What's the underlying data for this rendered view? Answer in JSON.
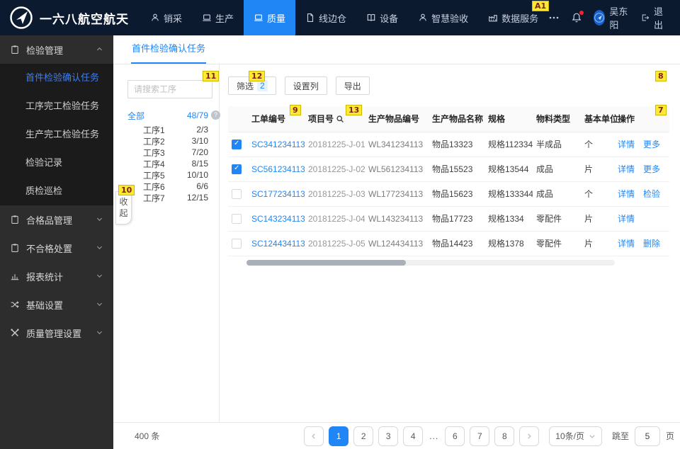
{
  "topnav": {
    "brand": "一六八航空航天",
    "items": [
      {
        "label": "销采",
        "icon": "person-icon",
        "active": false
      },
      {
        "label": "生产",
        "icon": "laptop-icon",
        "active": false
      },
      {
        "label": "质量",
        "icon": "laptop-icon",
        "active": true
      },
      {
        "label": "线边仓",
        "icon": "file-icon",
        "active": false
      },
      {
        "label": "设备",
        "icon": "book-icon",
        "active": false
      },
      {
        "label": "智慧验收",
        "icon": "person-icon",
        "active": false
      },
      {
        "label": "数据服务",
        "icon": "factory-icon",
        "active": false
      }
    ],
    "user": "吴东阳",
    "logout_label": "退出"
  },
  "sidebar": {
    "groups": [
      {
        "label": "检验管理",
        "icon": "clipboard-icon",
        "expanded": true,
        "children": [
          {
            "label": "首件检验确认任务",
            "active": true
          },
          {
            "label": "工序完工检验任务",
            "active": false
          },
          {
            "label": "生产完工检验任务",
            "active": false
          },
          {
            "label": "检验记录",
            "active": false
          },
          {
            "label": "质检巡检",
            "active": false
          }
        ]
      },
      {
        "label": "合格品管理",
        "icon": "clipboard-icon",
        "expanded": false
      },
      {
        "label": "不合格处置",
        "icon": "clipboard-icon",
        "expanded": false
      },
      {
        "label": "报表统计",
        "icon": "chart-icon",
        "expanded": false
      },
      {
        "label": "基础设置",
        "icon": "shuffle-icon",
        "expanded": false
      },
      {
        "label": "质量管理设置",
        "icon": "tools-icon",
        "expanded": false
      }
    ]
  },
  "tabbar": {
    "active_tab": "首件检验确认任务"
  },
  "filter_panel": {
    "search_placeholder": "请搜索工序",
    "all_label": "全部",
    "all_count": "48/79",
    "items": [
      {
        "name": "工序1",
        "count": "2/3"
      },
      {
        "name": "工序2",
        "count": "3/10"
      },
      {
        "name": "工序3",
        "count": "7/20"
      },
      {
        "name": "工序4",
        "count": "8/15"
      },
      {
        "name": "工序5",
        "count": "10/10"
      },
      {
        "name": "工序6",
        "count": "6/6"
      },
      {
        "name": "工序7",
        "count": "12/15"
      }
    ],
    "collapse_label": "收起"
  },
  "toolbar": {
    "filter_label": "筛选",
    "filter_count": "2",
    "columns_label": "设置列",
    "export_label": "导出"
  },
  "table": {
    "headers": [
      "工单编号",
      "项目号",
      "生产物品编号",
      "生产物品名称",
      "规格",
      "物料类型",
      "基本单位",
      "操作"
    ],
    "rows": [
      {
        "checked": true,
        "order": "SC341234113",
        "project": "20181225-J-01",
        "item_code": "WL341234113",
        "item_name": "物品13323",
        "spec": "规格112334",
        "material_type": "半成品",
        "unit": "个",
        "actions": [
          "详情",
          "更多"
        ]
      },
      {
        "checked": true,
        "order": "SC561234113",
        "project": "20181225-J-02",
        "item_code": "WL561234113",
        "item_name": "物品15523",
        "spec": "规格13544",
        "material_type": "成品",
        "unit": "片",
        "actions": [
          "详情",
          "更多"
        ]
      },
      {
        "checked": false,
        "order": "SC177234113",
        "project": "20181225-J-03",
        "item_code": "WL177234113",
        "item_name": "物品15623",
        "spec": "规格133344",
        "material_type": "成品",
        "unit": "个",
        "actions": [
          "详情",
          "检验"
        ]
      },
      {
        "checked": false,
        "order": "SC143234113",
        "project": "20181225-J-04",
        "item_code": "WL143234113",
        "item_name": "物品17723",
        "spec": "规格1334",
        "material_type": "零配件",
        "unit": "片",
        "actions": [
          "详情"
        ]
      },
      {
        "checked": false,
        "order": "SC124434113",
        "project": "20181225-J-05",
        "item_code": "WL124434113",
        "item_name": "物品14423",
        "spec": "规格1378",
        "material_type": "零配件",
        "unit": "片",
        "actions": [
          "详情",
          "删除"
        ]
      }
    ]
  },
  "footer": {
    "total": "400 条",
    "pages": [
      "1",
      "2",
      "3",
      "4",
      "...",
      "6",
      "7",
      "8"
    ],
    "current_page": "1",
    "page_size": "10条/页",
    "jump_label": "跳至",
    "jump_value": "5",
    "page_label": "页"
  },
  "annotations": {
    "a1": "A1",
    "n7": "7",
    "n8": "8",
    "n9": "9",
    "n10": "10",
    "n11": "11",
    "n12": "12",
    "n13": "13"
  },
  "colors": {
    "accent": "#2186f5",
    "topnav_bg": "#0c1a30",
    "sidebar_bg": "#2d2d2d",
    "active_nav_bg": "#2186f5",
    "badge_bg": "#ffe935",
    "badge_text": "#7c1f14",
    "link": "#2186f5"
  }
}
